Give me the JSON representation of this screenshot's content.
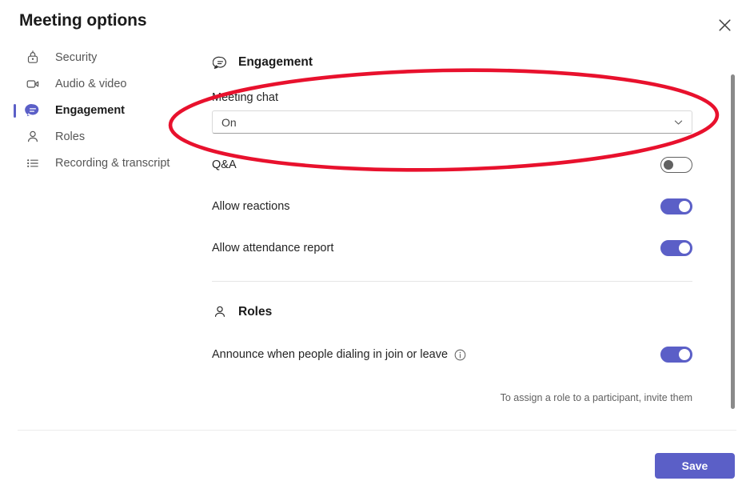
{
  "dialog": {
    "title": "Meeting options",
    "close_label": "Close",
    "close_icon": "close-icon"
  },
  "sidebar": {
    "items": [
      {
        "label": "Security",
        "icon": "lock-icon",
        "active": false
      },
      {
        "label": "Audio & video",
        "icon": "video-camera-icon",
        "active": false
      },
      {
        "label": "Engagement",
        "icon": "chat-bubble-icon",
        "active": true
      },
      {
        "label": "Roles",
        "icon": "person-icon",
        "active": false
      },
      {
        "label": "Recording & transcript",
        "icon": "list-icon",
        "active": false
      }
    ]
  },
  "main": {
    "engagement": {
      "title": "Engagement",
      "icon": "chat-bubble-outline-icon",
      "meeting_chat": {
        "label": "Meeting chat",
        "value": "On",
        "chevron_icon": "chevron-down-icon"
      },
      "toggles": [
        {
          "label": "Q&A",
          "state": "off"
        },
        {
          "label": "Allow reactions",
          "state": "on"
        },
        {
          "label": "Allow attendance report",
          "state": "on"
        }
      ]
    },
    "roles": {
      "title": "Roles",
      "icon": "person-outline-icon",
      "toggles": [
        {
          "label": "Announce when people dialing in join or leave",
          "state": "on",
          "info_icon": "info-icon"
        }
      ],
      "hint": "To assign a role to a participant, invite them"
    }
  },
  "footer": {
    "save_label": "Save"
  },
  "annotation": {
    "shape": "ellipse",
    "color": "#e8112d"
  },
  "colors": {
    "accent": "#5b5fc7",
    "annotation_red": "#e8112d",
    "toggle_off_border": "#616161",
    "text_primary": "#242424",
    "text_secondary": "#565656"
  }
}
